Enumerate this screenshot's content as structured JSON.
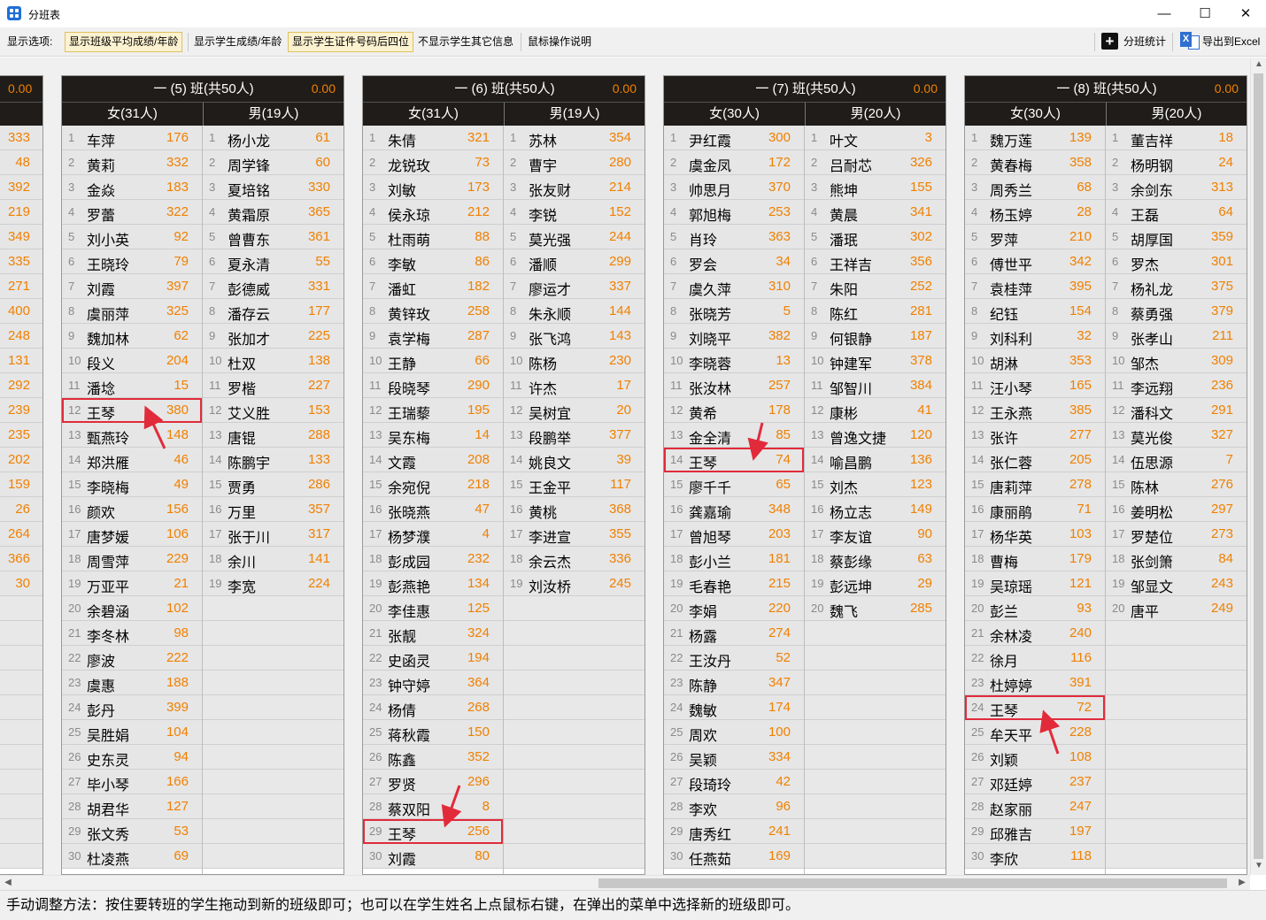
{
  "window": {
    "title": "分班表",
    "minimize": "—",
    "maximize": "☐",
    "close": "✕"
  },
  "toolbar": {
    "label": "显示选项:",
    "btn1": "显示班级平均成绩/年龄",
    "btn2": "显示学生成绩/年龄",
    "btn3": "显示学生证件号码后四位",
    "btn4": "不显示学生其它信息",
    "btn5": "鼠标操作说明",
    "stats": "分班统计",
    "export": "导出到Excel"
  },
  "left_strip": {
    "avg": "0.00",
    "scores": [
      "333",
      "48",
      "392",
      "219",
      "349",
      "335",
      "271",
      "400",
      "248",
      "131",
      "292",
      "239",
      "235",
      "202",
      "159",
      "26",
      "264",
      "366",
      "30"
    ]
  },
  "classes": [
    {
      "title": "一 (5) 班(共50人)",
      "avg": "0.00",
      "female_header": "女(31人)",
      "male_header": "男(19人)",
      "female": [
        [
          "车萍",
          "176"
        ],
        [
          "黄莉",
          "332"
        ],
        [
          "金焱",
          "183"
        ],
        [
          "罗蕾",
          "322"
        ],
        [
          "刘小英",
          "92"
        ],
        [
          "王晓玲",
          "79"
        ],
        [
          "刘霞",
          "397"
        ],
        [
          "虞丽萍",
          "325"
        ],
        [
          "魏加林",
          "62"
        ],
        [
          "段义",
          "204"
        ],
        [
          "潘埝",
          "15"
        ],
        [
          "王琴",
          "380"
        ],
        [
          "甄燕玲",
          "148"
        ],
        [
          "郑洪雁",
          "46"
        ],
        [
          "李晓梅",
          "49"
        ],
        [
          "颜欢",
          "156"
        ],
        [
          "唐梦媛",
          "106"
        ],
        [
          "周雪萍",
          "229"
        ],
        [
          "万亚平",
          "21"
        ],
        [
          "余碧涵",
          "102"
        ],
        [
          "李冬林",
          "98"
        ],
        [
          "廖波",
          "222"
        ],
        [
          "虞惠",
          "188"
        ],
        [
          "彭丹",
          "399"
        ],
        [
          "吴胜娟",
          "104"
        ],
        [
          "史东灵",
          "94"
        ],
        [
          "毕小琴",
          "166"
        ],
        [
          "胡君华",
          "127"
        ],
        [
          "张文秀",
          "53"
        ],
        [
          "杜凌燕",
          "69"
        ]
      ],
      "male": [
        [
          "杨小龙",
          "61"
        ],
        [
          "周学锋",
          "60"
        ],
        [
          "夏培铭",
          "330"
        ],
        [
          "黄霜原",
          "365"
        ],
        [
          "曾曹东",
          "361"
        ],
        [
          "夏永清",
          "55"
        ],
        [
          "彭德威",
          "331"
        ],
        [
          "潘存云",
          "177"
        ],
        [
          "张加才",
          "225"
        ],
        [
          "杜双",
          "138"
        ],
        [
          "罗楷",
          "227"
        ],
        [
          "艾义胜",
          "153"
        ],
        [
          "唐锟",
          "288"
        ],
        [
          "陈鹏宇",
          "133"
        ],
        [
          "贾勇",
          "286"
        ],
        [
          "万里",
          "357"
        ],
        [
          "张于川",
          "317"
        ],
        [
          "余川",
          "141"
        ],
        [
          "李宽",
          "224"
        ]
      ]
    },
    {
      "title": "一 (6) 班(共50人)",
      "avg": "0.00",
      "female_header": "女(31人)",
      "male_header": "男(19人)",
      "female": [
        [
          "朱倩",
          "321"
        ],
        [
          "龙锐玫",
          "73"
        ],
        [
          "刘敏",
          "173"
        ],
        [
          "侯永琼",
          "212"
        ],
        [
          "杜雨萌",
          "88"
        ],
        [
          "李敏",
          "86"
        ],
        [
          "潘虹",
          "182"
        ],
        [
          "黄锌玫",
          "258"
        ],
        [
          "袁学梅",
          "287"
        ],
        [
          "王静",
          "66"
        ],
        [
          "段晓琴",
          "290"
        ],
        [
          "王瑞藜",
          "195"
        ],
        [
          "吴东梅",
          "14"
        ],
        [
          "文霞",
          "208"
        ],
        [
          "余宛倪",
          "218"
        ],
        [
          "张晓燕",
          "47"
        ],
        [
          "杨梦濮",
          "4"
        ],
        [
          "彭成园",
          "232"
        ],
        [
          "彭燕艳",
          "134"
        ],
        [
          "李佳惠",
          "125"
        ],
        [
          "张靓",
          "324"
        ],
        [
          "史函灵",
          "194"
        ],
        [
          "钟守婷",
          "364"
        ],
        [
          "杨倩",
          "268"
        ],
        [
          "蒋秋霞",
          "150"
        ],
        [
          "陈鑫",
          "352"
        ],
        [
          "罗贤",
          "296"
        ],
        [
          "蔡双阳",
          "8"
        ],
        [
          "王琴",
          "256"
        ],
        [
          "刘霞",
          "80"
        ]
      ],
      "male": [
        [
          "苏林",
          "354"
        ],
        [
          "曹宇",
          "280"
        ],
        [
          "张友财",
          "214"
        ],
        [
          "李锐",
          "152"
        ],
        [
          "莫光强",
          "244"
        ],
        [
          "潘顺",
          "299"
        ],
        [
          "廖运才",
          "337"
        ],
        [
          "朱永顺",
          "144"
        ],
        [
          "张飞鸿",
          "143"
        ],
        [
          "陈杨",
          "230"
        ],
        [
          "许杰",
          "17"
        ],
        [
          "吴树宜",
          "20"
        ],
        [
          "段鹏举",
          "377"
        ],
        [
          "姚良文",
          "39"
        ],
        [
          "王金平",
          "117"
        ],
        [
          "黄桃",
          "368"
        ],
        [
          "李进宣",
          "355"
        ],
        [
          "余云杰",
          "336"
        ],
        [
          "刘汝桥",
          "245"
        ]
      ]
    },
    {
      "title": "一 (7) 班(共50人)",
      "avg": "0.00",
      "female_header": "女(30人)",
      "male_header": "男(20人)",
      "female": [
        [
          "尹红霞",
          "300"
        ],
        [
          "虞金凤",
          "172"
        ],
        [
          "帅思月",
          "370"
        ],
        [
          "郭旭梅",
          "253"
        ],
        [
          "肖玲",
          "363"
        ],
        [
          "罗会",
          "34"
        ],
        [
          "虞久萍",
          "310"
        ],
        [
          "张晓芳",
          "5"
        ],
        [
          "刘晓平",
          "382"
        ],
        [
          "李晓蓉",
          "13"
        ],
        [
          "张汝林",
          "257"
        ],
        [
          "黄希",
          "178"
        ],
        [
          "金全清",
          "85"
        ],
        [
          "王琴",
          "74"
        ],
        [
          "廖千千",
          "65"
        ],
        [
          "龚嘉瑜",
          "348"
        ],
        [
          "曾旭琴",
          "203"
        ],
        [
          "彭小兰",
          "181"
        ],
        [
          "毛春艳",
          "215"
        ],
        [
          "李娟",
          "220"
        ],
        [
          "杨露",
          "274"
        ],
        [
          "王汝丹",
          "52"
        ],
        [
          "陈静",
          "347"
        ],
        [
          "魏敏",
          "174"
        ],
        [
          "周欢",
          "100"
        ],
        [
          "吴颖",
          "334"
        ],
        [
          "段琦玲",
          "42"
        ],
        [
          "李欢",
          "96"
        ],
        [
          "唐秀红",
          "241"
        ],
        [
          "任燕茹",
          "169"
        ]
      ],
      "male": [
        [
          "叶文",
          "3"
        ],
        [
          "吕耐芯",
          "326"
        ],
        [
          "熊坤",
          "155"
        ],
        [
          "黄晨",
          "341"
        ],
        [
          "潘珉",
          "302"
        ],
        [
          "王祥吉",
          "356"
        ],
        [
          "朱阳",
          "252"
        ],
        [
          "陈红",
          "281"
        ],
        [
          "何银静",
          "187"
        ],
        [
          "钟建军",
          "378"
        ],
        [
          "邹智川",
          "384"
        ],
        [
          "康彬",
          "41"
        ],
        [
          "曾逸文捷",
          "120"
        ],
        [
          "喻昌鹏",
          "136"
        ],
        [
          "刘杰",
          "123"
        ],
        [
          "杨立志",
          "149"
        ],
        [
          "李友谊",
          "90"
        ],
        [
          "蔡彭缘",
          "63"
        ],
        [
          "彭远坤",
          "29"
        ],
        [
          "魏飞",
          "285"
        ]
      ]
    },
    {
      "title": "一 (8) 班(共50人)",
      "avg": "0.00",
      "female_header": "女(30人)",
      "male_header": "男(20人)",
      "female": [
        [
          "魏万莲",
          "139"
        ],
        [
          "黄春梅",
          "358"
        ],
        [
          "周秀兰",
          "68"
        ],
        [
          "杨玉婷",
          "28"
        ],
        [
          "罗萍",
          "210"
        ],
        [
          "傅世平",
          "342"
        ],
        [
          "袁桂萍",
          "395"
        ],
        [
          "纪钰",
          "154"
        ],
        [
          "刘科利",
          "32"
        ],
        [
          "胡淋",
          "353"
        ],
        [
          "汪小琴",
          "165"
        ],
        [
          "王永燕",
          "385"
        ],
        [
          "张许",
          "277"
        ],
        [
          "张仁蓉",
          "205"
        ],
        [
          "唐莉萍",
          "278"
        ],
        [
          "康丽鹃",
          "71"
        ],
        [
          "杨华英",
          "103"
        ],
        [
          "曹梅",
          "179"
        ],
        [
          "吴琼瑶",
          "121"
        ],
        [
          "彭兰",
          "93"
        ],
        [
          "余林凌",
          "240"
        ],
        [
          "徐月",
          "116"
        ],
        [
          "杜婷婷",
          "391"
        ],
        [
          "王琴",
          "72"
        ],
        [
          "牟天平",
          "228"
        ],
        [
          "刘颖",
          "108"
        ],
        [
          "邓廷婷",
          "237"
        ],
        [
          "赵家丽",
          "247"
        ],
        [
          "邱雅吉",
          "197"
        ],
        [
          "李欣",
          "118"
        ]
      ],
      "male": [
        [
          "董吉祥",
          "18"
        ],
        [
          "杨明钢",
          "24"
        ],
        [
          "余剑东",
          "313"
        ],
        [
          "王磊",
          "64"
        ],
        [
          "胡厚国",
          "359"
        ],
        [
          "罗杰",
          "301"
        ],
        [
          "杨礼龙",
          "375"
        ],
        [
          "蔡勇强",
          "379"
        ],
        [
          "张孝山",
          "211"
        ],
        [
          "邹杰",
          "309"
        ],
        [
          "李远翔",
          "236"
        ],
        [
          "潘科文",
          "291"
        ],
        [
          "莫光俊",
          "327"
        ],
        [
          "伍思源",
          "7"
        ],
        [
          "陈林",
          "276"
        ],
        [
          "姜明松",
          "297"
        ],
        [
          "罗楚位",
          "273"
        ],
        [
          "张剑箫",
          "84"
        ],
        [
          "邹显文",
          "243"
        ],
        [
          "唐平",
          "249"
        ]
      ]
    }
  ],
  "highlights": [
    {
      "class": 0,
      "side": "female",
      "index": 11
    },
    {
      "class": 1,
      "side": "female",
      "index": 28
    },
    {
      "class": 2,
      "side": "female",
      "index": 13
    },
    {
      "class": 3,
      "side": "female",
      "index": 23
    }
  ],
  "colors": {
    "header_bg": "#1f1c19",
    "score": "#f08000",
    "highlight": "#e12b3b"
  },
  "status": "手动调整方法：按住要转班的学生拖动到新的班级即可；也可以在学生姓名上点鼠标右键，在弹出的菜单中选择新的班级即可。"
}
